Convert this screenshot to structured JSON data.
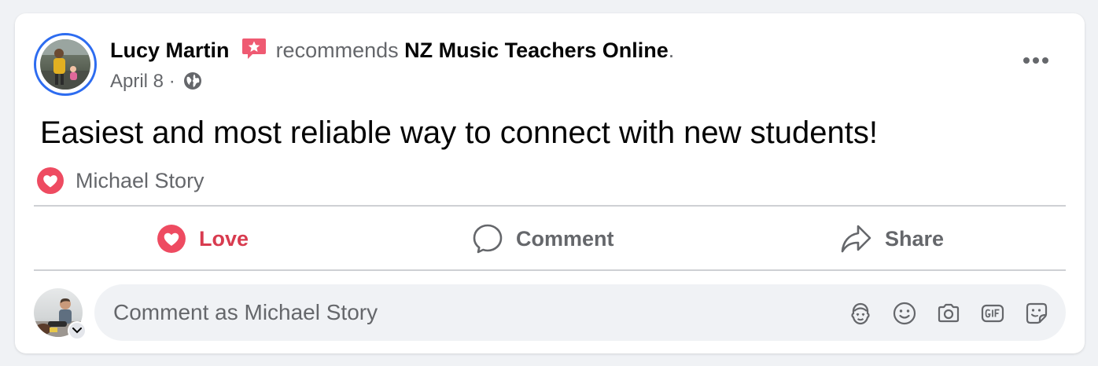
{
  "post": {
    "author": "Lucy Martin",
    "action_text": "recommends",
    "page_name": "NZ Music Teachers Online",
    "period": ".",
    "date": "April 8",
    "separator": "·",
    "privacy_icon": "globe-icon",
    "menu_icon": "more-options-icon",
    "text": "Easiest and most reliable way to connect with new students!"
  },
  "reactions": {
    "icon": "love-reaction-icon",
    "names": "Michael Story"
  },
  "actions": [
    {
      "label": "Love",
      "icon": "love-icon",
      "active": true,
      "color": "#d83b4f"
    },
    {
      "label": "Comment",
      "icon": "comment-icon"
    },
    {
      "label": "Share",
      "icon": "share-icon"
    }
  ],
  "composer": {
    "placeholder": "Comment as Michael Story",
    "tools": [
      "avatar-sticker-icon",
      "emoji-icon",
      "camera-icon",
      "gif-icon",
      "sticker-icon"
    ]
  },
  "colors": {
    "accent": "#2d6cf0",
    "love": "#d83b4f",
    "muted": "#65676b"
  }
}
